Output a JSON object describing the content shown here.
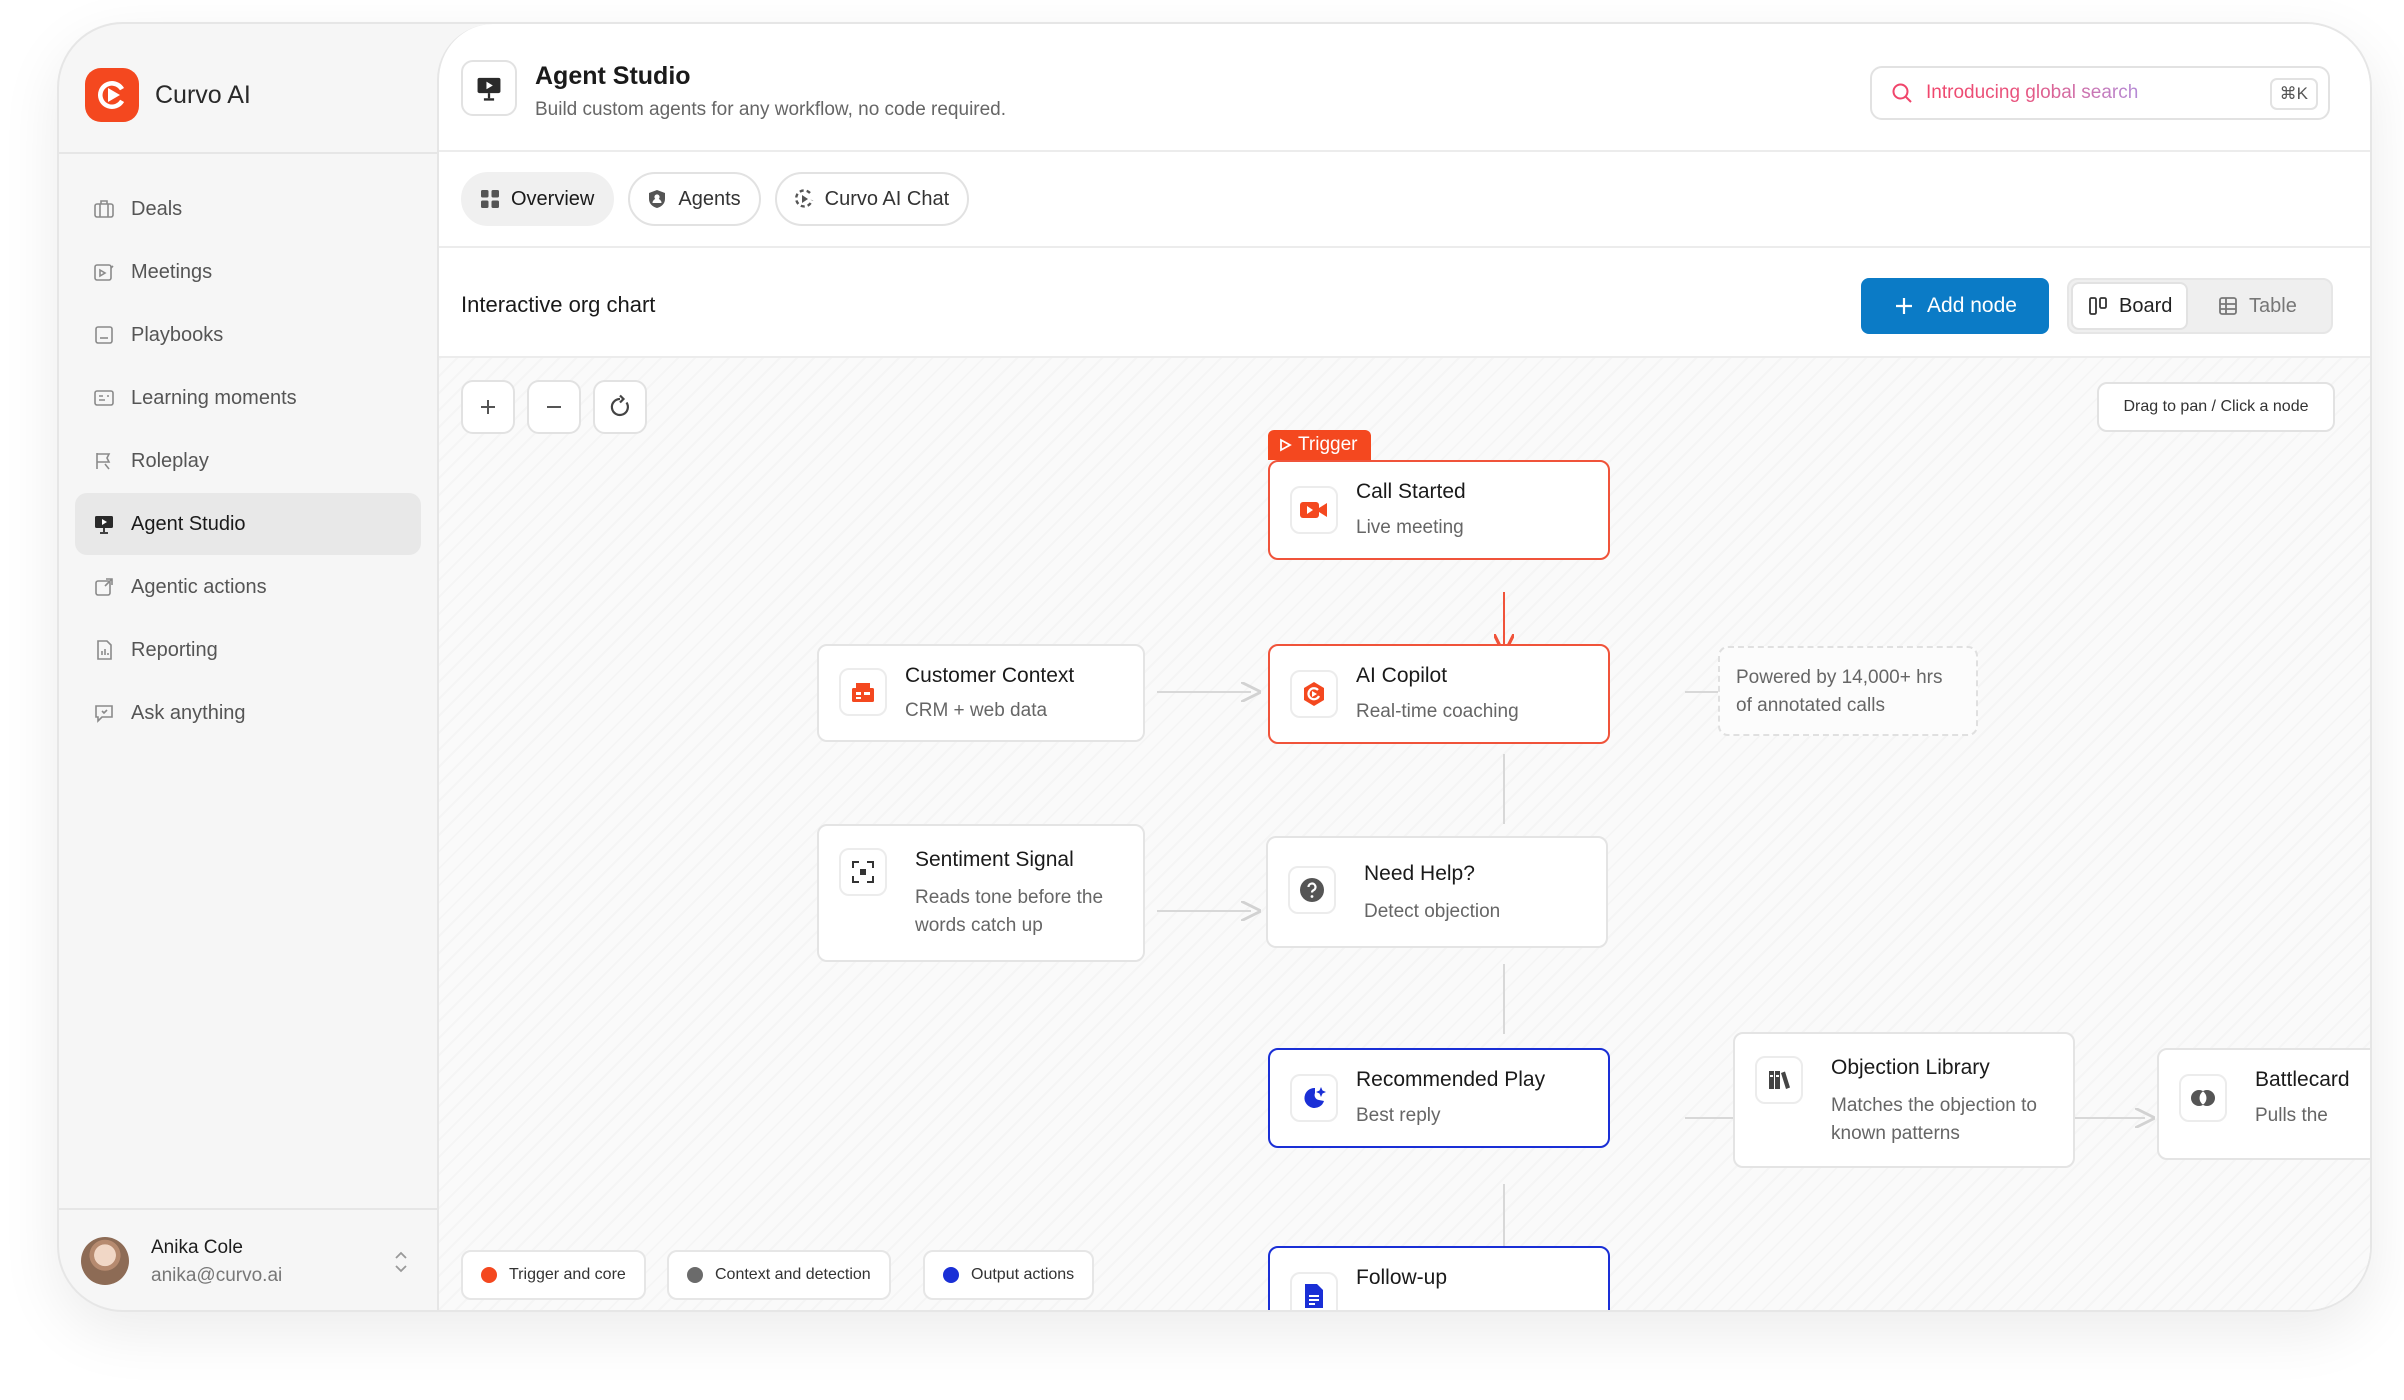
{
  "brand": {
    "name": "Curvo AI"
  },
  "sidebar": {
    "items": [
      {
        "label": "Deals"
      },
      {
        "label": "Meetings"
      },
      {
        "label": "Playbooks"
      },
      {
        "label": "Learning moments"
      },
      {
        "label": "Roleplay"
      },
      {
        "label": "Agent Studio",
        "active": true
      },
      {
        "label": "Agentic actions"
      },
      {
        "label": "Reporting"
      },
      {
        "label": "Ask anything"
      }
    ]
  },
  "user": {
    "name": "Anika Cole",
    "email": "anika@curvo.ai"
  },
  "header": {
    "title": "Agent Studio",
    "subtitle": "Build custom agents for any workflow, no code required.",
    "search_placeholder": "Introducing global search",
    "shortcut": "⌘K"
  },
  "tabs": [
    {
      "label": "Overview",
      "active": true
    },
    {
      "label": "Agents"
    },
    {
      "label": "Curvo AI Chat"
    }
  ],
  "toolbar": {
    "title": "Interactive org chart",
    "add_node": "Add node",
    "view_board": "Board",
    "view_table": "Table",
    "active_view": "Board"
  },
  "canvas": {
    "hint": "Drag to pan / Click a node",
    "trigger_tag": "Trigger",
    "note": "Powered by 14,000+ hrs of annotated calls",
    "nodes": {
      "call_started": {
        "title": "Call Started",
        "subtitle": "Live meeting"
      },
      "customer_context": {
        "title": "Customer Context",
        "subtitle": "CRM + web data"
      },
      "ai_copilot": {
        "title": "AI Copilot",
        "subtitle": "Real-time coaching"
      },
      "sentiment_signal": {
        "title": "Sentiment Signal",
        "subtitle": "Reads tone before the words catch up"
      },
      "need_help": {
        "title": "Need Help?",
        "subtitle": "Detect objection"
      },
      "recommended_play": {
        "title": "Recommended Play",
        "subtitle": "Best reply"
      },
      "objection_library": {
        "title": "Objection Library",
        "subtitle": "Matches the objection to known patterns"
      },
      "battlecard": {
        "title": "Battlecard",
        "subtitle": "Pulls the"
      },
      "follow_up": {
        "title": "Follow-up"
      }
    },
    "legend": [
      {
        "label": "Trigger and core",
        "color": "#f4481f"
      },
      {
        "label": "Context and detection",
        "color": "#6b6b6b"
      },
      {
        "label": "Output actions",
        "color": "#1a2fd6"
      }
    ]
  },
  "colors": {
    "accent": "#f4481f",
    "primary_button": "#0b7bc6",
    "output_blue": "#1a2fd6"
  }
}
